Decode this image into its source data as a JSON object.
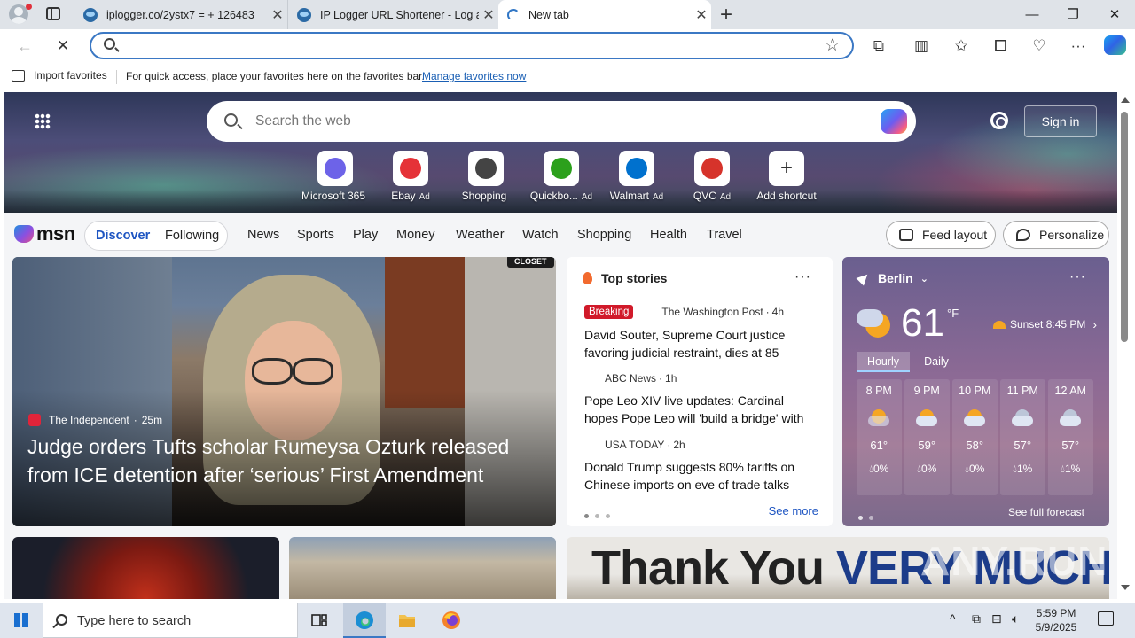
{
  "browser": {
    "tabs": [
      {
        "title": "iplogger.co/2ystx7 = + 126483",
        "active": false
      },
      {
        "title": "IP Logger URL Shortener - Log and",
        "active": false
      },
      {
        "title": "New tab",
        "active": true
      }
    ],
    "window_controls": {
      "minimize": "—",
      "restore": "❐",
      "close": "✕"
    },
    "address": {
      "value": "",
      "placeholder": ""
    },
    "favorites_bar": {
      "import_label": "Import favorites",
      "message": "For quick access, place your favorites here on the favorites bar.",
      "manage_link": "Manage favorites now"
    }
  },
  "msn": {
    "search_placeholder": "Search the web",
    "sign_in": "Sign in",
    "shortcuts": [
      {
        "label": "Microsoft 365",
        "ad": "",
        "color": "#6d63e8"
      },
      {
        "label": "Ebay",
        "ad": "Ad",
        "color": "#e53238"
      },
      {
        "label": "Shopping",
        "ad": "",
        "color": "#444444"
      },
      {
        "label": "Quickbo...",
        "ad": "Ad",
        "color": "#2ca01c"
      },
      {
        "label": "Walmart",
        "ad": "Ad",
        "color": "#0071ce"
      },
      {
        "label": "QVC",
        "ad": "Ad",
        "color": "#d6332b"
      },
      {
        "label": "Add shortcut",
        "ad": "",
        "color": ""
      }
    ],
    "logo_text": "msn",
    "feed_tabs": {
      "discover": "Discover",
      "following": "Following"
    },
    "nav_links": [
      "News",
      "Sports",
      "Play",
      "Money",
      "Weather",
      "Watch",
      "Shopping",
      "Health",
      "Travel"
    ],
    "feed_layout": "Feed layout",
    "personalize": "Personalize",
    "main_story": {
      "source": "The Independent",
      "age": "25m",
      "badge": "CLOSET",
      "headline": "Judge orders Tufts scholar Rumeysa Ozturk released from ICE detention after ‘serious’ First Amendment violation"
    },
    "top_stories": {
      "title": "Top stories",
      "items": [
        {
          "badge": "Breaking",
          "source": "The Washington Post",
          "age": "4h",
          "headline": "David Souter, Supreme Court justice favoring judicial restraint, dies at 85",
          "logo_color": "#111111"
        },
        {
          "badge": "",
          "source": "ABC News",
          "age": "1h",
          "headline": "Pope Leo XIV live updates: Cardinal hopes Pope Leo will 'build a bridge' with the world",
          "logo_color": "#222222"
        },
        {
          "badge": "",
          "source": "USA TODAY",
          "age": "2h",
          "headline": "Donald Trump suggests 80% tariffs on Chinese imports on eve of trade talks",
          "logo_color": "#1d9bd7"
        }
      ],
      "see_more": "See more"
    },
    "weather": {
      "location": "Berlin",
      "temp": "61",
      "unit": "°F",
      "sunset": "Sunset 8:45 PM",
      "tabs": [
        "Hourly",
        "Daily"
      ],
      "hours": [
        {
          "time": "8 PM",
          "temp": "61°",
          "precip": "0%"
        },
        {
          "time": "9 PM",
          "temp": "59°",
          "precip": "0%"
        },
        {
          "time": "10 PM",
          "temp": "58°",
          "precip": "0%"
        },
        {
          "time": "11 PM",
          "temp": "57°",
          "precip": "1%"
        },
        {
          "time": "12 AM",
          "temp": "57°",
          "precip": "1%"
        }
      ],
      "see_full": "See full forecast"
    },
    "lower_banner_text": {
      "a": "Thank You ",
      "b": "VERY MUCH"
    }
  },
  "watermark": "ANY.RUN",
  "taskbar": {
    "search_placeholder": "Type here to search",
    "time": "5:59 PM",
    "date": "5/9/2025"
  }
}
